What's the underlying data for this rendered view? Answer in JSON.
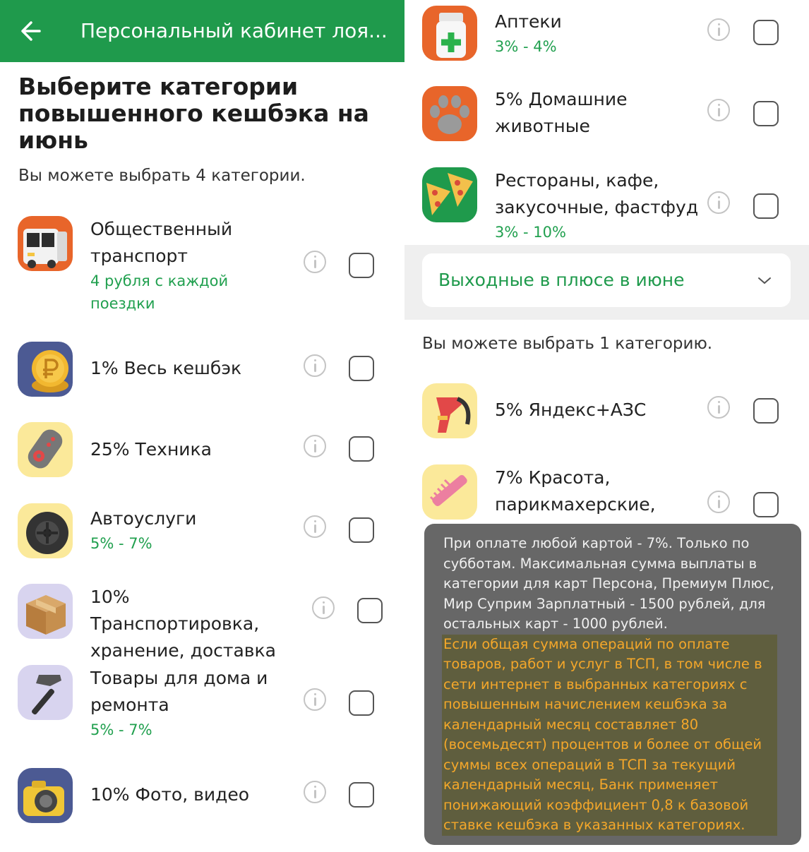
{
  "header": {
    "title": "Персональный кабинет лоя..."
  },
  "main": {
    "heading": "Выберите категории повышенного кешбэка на июнь",
    "choose_hint": "Вы можете выбрать 4 категории.",
    "categories": [
      {
        "title": "Общественный транспорт",
        "sub": "4 рубля с каждой поездки",
        "icon": "bus-icon"
      },
      {
        "title": "1% Весь кешбэк",
        "sub": "",
        "icon": "ruble-coin-icon"
      },
      {
        "title": "25% Техника",
        "sub": "",
        "icon": "remote-control-icon"
      },
      {
        "title": "Автоуслуги",
        "sub": "5% - 7%",
        "icon": "tire-icon"
      },
      {
        "title": "10% Транспортировка, хранение, доставка",
        "sub": "",
        "icon": "box-icon"
      },
      {
        "title": "Товары для дома и ремонта",
        "sub": "5% - 7%",
        "icon": "hammer-icon"
      },
      {
        "title": "10% Фото, видео",
        "sub": "",
        "icon": "camera-icon"
      }
    ],
    "categories_more": [
      {
        "title": "Аптеки",
        "sub": "3% - 4%",
        "icon": "pill-bottle-icon"
      },
      {
        "title": "5% Домашние животные",
        "sub": "",
        "icon": "paw-icon"
      },
      {
        "title": "Рестораны, кафе, закусочные, фастфуд",
        "sub": "3% - 10%",
        "icon": "pizza-icon"
      }
    ]
  },
  "weekend": {
    "dropdown_label": "Выходные в плюсе в июне",
    "choose_hint": "Вы можете выбрать 1 категорию.",
    "categories": [
      {
        "title": "5% Яндекс+АЗС",
        "icon": "fuel-nozzle-icon"
      },
      {
        "title": "7% Красота, парикмахерские,",
        "icon": "comb-icon"
      }
    ]
  },
  "tooltip": {
    "main_text": "При оплате любой картой - 7%. Только по субботам. Максимальная сумма выплаты в категории для карт Персона, Премиум Плюс, Мир Суприм Зарплатный - 1500 рублей, для остальных карт - 1000 рублей.",
    "highlighted_text": "Если общая сумма операций по оплате товаров, работ и услуг в ТСП, в том числе в сети интернет в выбранных категориях с повышенным начислением кешбэка за календарный месяц составляет 80 (восемьдесят) процентов и более от общей суммы всех операций в ТСП за текущий календарный месяц, Банк применяет понижающий коэффициент 0,8 к базовой ставке кешбэка в указанных категориях."
  },
  "colors": {
    "brand_green": "#1f9a4c",
    "cashback_green": "#21a04f",
    "tooltip_bg": "#676767",
    "tooltip_highlight": "#f4a72a"
  }
}
